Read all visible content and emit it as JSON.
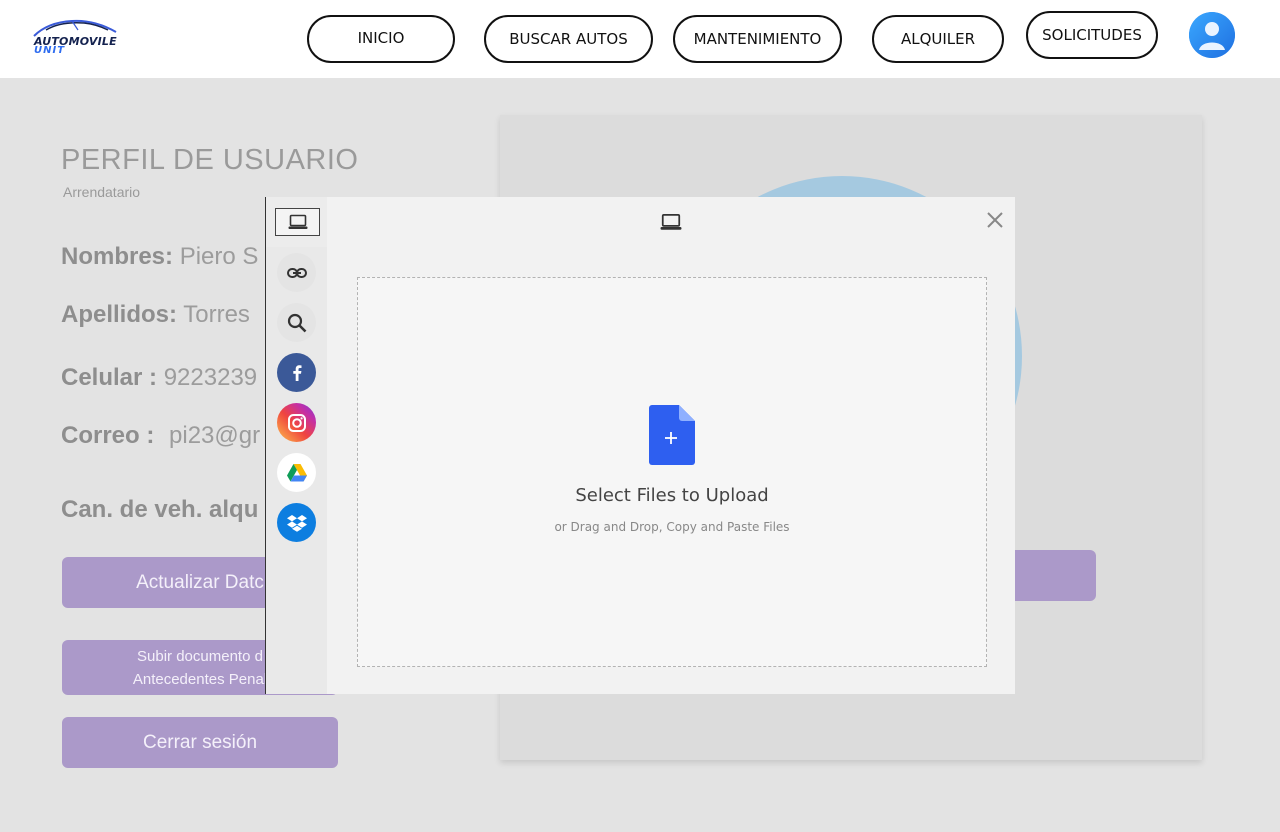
{
  "header": {
    "logo": {
      "line1": "AUTOMOVILE",
      "line2": "UNIT",
      "icon": "car-logo"
    },
    "nav": [
      {
        "label": "INICIO"
      },
      {
        "label": "BUSCAR AUTOS"
      },
      {
        "label": "MANTENIMIENTO"
      },
      {
        "label": "ALQUILER"
      },
      {
        "label": "SOLICITUDES"
      }
    ],
    "avatar_icon": "user-avatar-icon"
  },
  "profile": {
    "title": "PERFIL DE USUARIO",
    "role": "Arrendatario",
    "fields": [
      {
        "label": "Nombres:",
        "value": "Piero S"
      },
      {
        "label": "Apellidos:",
        "value": "Torres"
      },
      {
        "label": "Celular :",
        "value": "9223239"
      },
      {
        "label": "Correo :",
        "value": "pi23@gr"
      },
      {
        "label": "Can. de veh. alqu",
        "value": ""
      }
    ],
    "buttons": {
      "update": "Actualizar Datc",
      "upload_doc_line1": "Subir documento d",
      "upload_doc_line2": "Antecedentes Penal",
      "logout": "Cerrar sesión"
    }
  },
  "uploader": {
    "title": "Select Files to Upload",
    "subtitle": "or Drag and Drop, Copy and Paste Files",
    "sources": [
      {
        "name": "link",
        "icon": "link-icon"
      },
      {
        "name": "search",
        "icon": "search-icon"
      },
      {
        "name": "facebook",
        "icon": "facebook-icon"
      },
      {
        "name": "instagram",
        "icon": "instagram-icon"
      },
      {
        "name": "google-drive",
        "icon": "google-drive-icon"
      },
      {
        "name": "dropbox",
        "icon": "dropbox-icon"
      }
    ]
  },
  "colors": {
    "accent_purple": "#ab99c9",
    "brand_blue": "#2f6df0",
    "file_icon_blue": "#2e5ff0",
    "facebook": "#3b5998",
    "dropbox": "#0d7ee0"
  }
}
